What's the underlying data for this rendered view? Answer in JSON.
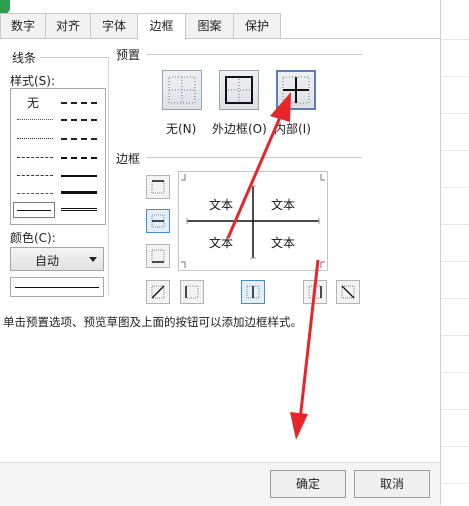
{
  "tabs": [
    {
      "label": "数字"
    },
    {
      "label": "对齐"
    },
    {
      "label": "字体"
    },
    {
      "label": "边框",
      "active": true
    },
    {
      "label": "图案"
    },
    {
      "label": "保护"
    }
  ],
  "line_group": {
    "title": "线条",
    "style_label": "样式(S):",
    "none_label": "无",
    "color_label": "颜色(C):",
    "color_value": "自动"
  },
  "preset_group": {
    "title": "预置",
    "items": [
      {
        "label": "无(N)",
        "icon": "border-none-icon"
      },
      {
        "label": "外边框(O)",
        "icon": "border-outline-icon"
      },
      {
        "label": "内部(I)",
        "icon": "border-inside-icon"
      }
    ]
  },
  "border_group": {
    "title": "边框",
    "preview_text": [
      "文本",
      "文本",
      "文本",
      "文本"
    ]
  },
  "hint": "单击预置选项、预览草图及上面的按钮可以添加边框样式。",
  "buttons": {
    "ok": "确定",
    "cancel": "取消"
  },
  "colors": {
    "accent": "#4a8bd6",
    "arrow": "#e8252b",
    "tab_border": "#c9c9c9"
  }
}
